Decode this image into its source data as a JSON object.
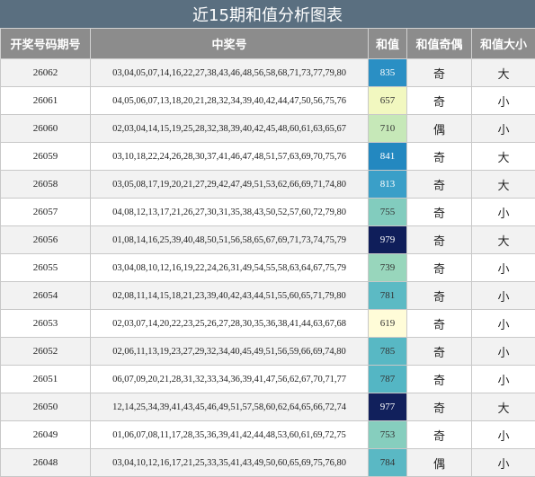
{
  "title": "近15期和值分析图表",
  "headers": [
    "开奖号码期号",
    "中奖号",
    "和值",
    "和值奇偶",
    "和值大小"
  ],
  "rows": [
    {
      "issue": "26062",
      "numbers": "03,04,05,07,14,16,22,27,38,43,46,48,56,58,68,71,73,77,79,80",
      "sum": "835",
      "parity": "奇",
      "size": "大",
      "sum_bg": "#2a8fc4",
      "sum_fg": "#ffffff"
    },
    {
      "issue": "26061",
      "numbers": "04,05,06,07,13,18,20,21,28,32,34,39,40,42,44,47,50,56,75,76",
      "sum": "657",
      "parity": "奇",
      "size": "小",
      "sum_bg": "#f2f8c0",
      "sum_fg": "#333333"
    },
    {
      "issue": "26060",
      "numbers": "02,03,04,14,15,19,25,28,32,38,39,40,42,45,48,60,61,63,65,67",
      "sum": "710",
      "parity": "偶",
      "size": "小",
      "sum_bg": "#c6e8b8",
      "sum_fg": "#333333"
    },
    {
      "issue": "26059",
      "numbers": "03,10,18,22,24,26,28,30,37,41,46,47,48,51,57,63,69,70,75,76",
      "sum": "841",
      "parity": "奇",
      "size": "大",
      "sum_bg": "#2388c0",
      "sum_fg": "#ffffff"
    },
    {
      "issue": "26058",
      "numbers": "03,05,08,17,19,20,21,27,29,42,47,49,51,53,62,66,69,71,74,80",
      "sum": "813",
      "parity": "奇",
      "size": "大",
      "sum_bg": "#3a9fc8",
      "sum_fg": "#ffffff"
    },
    {
      "issue": "26057",
      "numbers": "04,08,12,13,17,21,26,27,30,31,35,38,43,50,52,57,60,72,79,80",
      "sum": "755",
      "parity": "奇",
      "size": "小",
      "sum_bg": "#82ccbe",
      "sum_fg": "#333333"
    },
    {
      "issue": "26056",
      "numbers": "01,08,14,16,25,39,40,48,50,51,56,58,65,67,69,71,73,74,75,79",
      "sum": "979",
      "parity": "奇",
      "size": "大",
      "sum_bg": "#0f1e5a",
      "sum_fg": "#ffffff"
    },
    {
      "issue": "26055",
      "numbers": "03,04,08,10,12,16,19,22,24,26,31,49,54,55,58,63,64,67,75,79",
      "sum": "739",
      "parity": "奇",
      "size": "小",
      "sum_bg": "#98d6bc",
      "sum_fg": "#333333"
    },
    {
      "issue": "26054",
      "numbers": "02,08,11,14,15,18,21,23,39,40,42,43,44,51,55,60,65,71,79,80",
      "sum": "781",
      "parity": "奇",
      "size": "小",
      "sum_bg": "#5cbac4",
      "sum_fg": "#333333"
    },
    {
      "issue": "26053",
      "numbers": "02,03,07,14,20,22,23,25,26,27,28,30,35,36,38,41,44,63,67,68",
      "sum": "619",
      "parity": "奇",
      "size": "小",
      "sum_bg": "#fffcd8",
      "sum_fg": "#333333"
    },
    {
      "issue": "26052",
      "numbers": "02,06,11,13,19,23,27,29,32,34,40,45,49,51,56,59,66,69,74,80",
      "sum": "785",
      "parity": "奇",
      "size": "小",
      "sum_bg": "#58b8c4",
      "sum_fg": "#333333"
    },
    {
      "issue": "26051",
      "numbers": "06,07,09,20,21,28,31,32,33,34,36,39,41,47,56,62,67,70,71,77",
      "sum": "787",
      "parity": "奇",
      "size": "小",
      "sum_bg": "#54b6c4",
      "sum_fg": "#333333"
    },
    {
      "issue": "26050",
      "numbers": "12,14,25,34,39,41,43,45,46,49,51,57,58,60,62,64,65,66,72,74",
      "sum": "977",
      "parity": "奇",
      "size": "大",
      "sum_bg": "#11205c",
      "sum_fg": "#ffffff"
    },
    {
      "issue": "26049",
      "numbers": "01,06,07,08,11,17,28,35,36,39,41,42,44,48,53,60,61,69,72,75",
      "sum": "753",
      "parity": "奇",
      "size": "小",
      "sum_bg": "#86cebe",
      "sum_fg": "#333333"
    },
    {
      "issue": "26048",
      "numbers": "03,04,10,12,16,17,21,25,33,35,41,43,49,50,60,65,69,75,76,80",
      "sum": "784",
      "parity": "偶",
      "size": "小",
      "sum_bg": "#5ab8c4",
      "sum_fg": "#333333"
    }
  ]
}
